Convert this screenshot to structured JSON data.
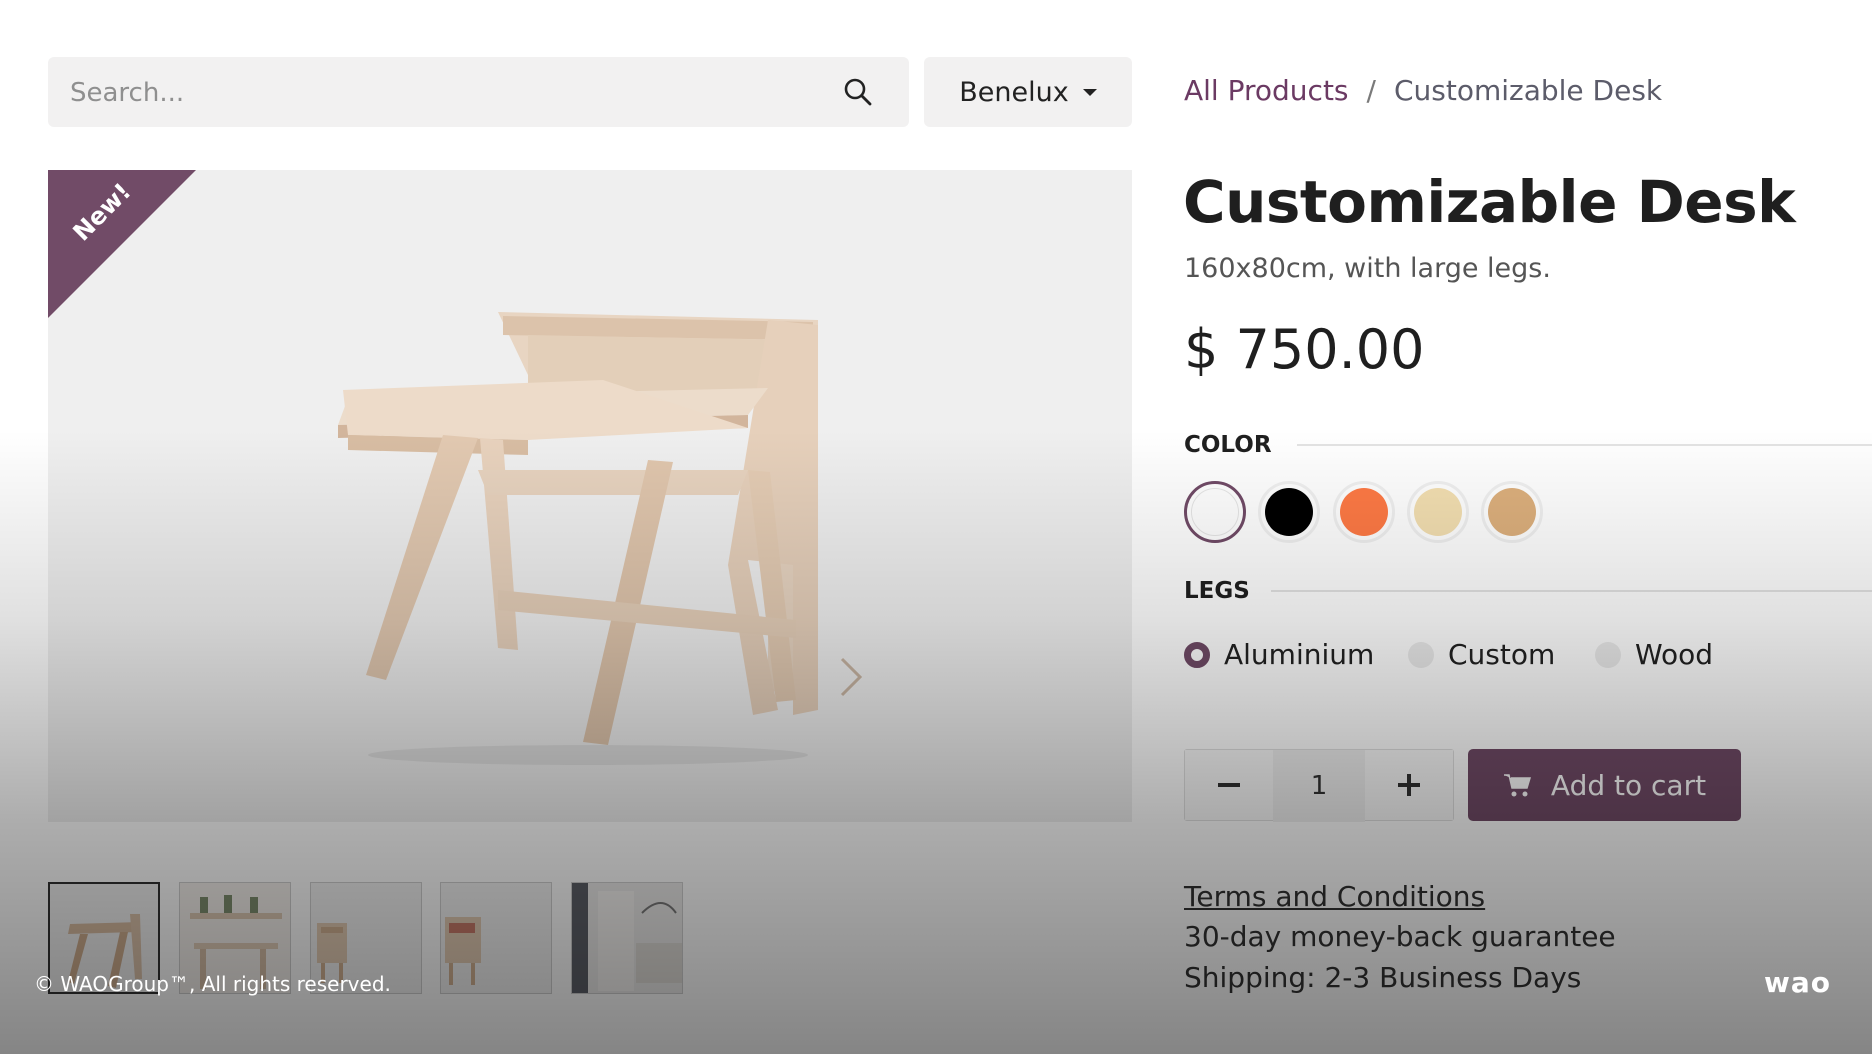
{
  "search": {
    "placeholder": "Search..."
  },
  "pricelist": {
    "label": "Benelux"
  },
  "breadcrumb": {
    "parent": "All Products",
    "separator": "/",
    "current": "Customizable Desk"
  },
  "badge": {
    "label": "New!"
  },
  "product": {
    "title": "Customizable Desk",
    "description": "160x80cm, with large legs.",
    "price": "$ 750.00"
  },
  "attributes": {
    "color": {
      "label": "COLOR",
      "swatches": [
        {
          "name": "White",
          "hex": "#ffffff",
          "selected": true
        },
        {
          "name": "Black",
          "hex": "#000000",
          "selected": false
        },
        {
          "name": "Orange",
          "hex": "#ff7a45",
          "selected": false
        },
        {
          "name": "Beige",
          "hex": "#f3dfb1",
          "selected": false
        },
        {
          "name": "Tan",
          "hex": "#ddb07d",
          "selected": false
        }
      ]
    },
    "legs": {
      "label": "LEGS",
      "options": [
        {
          "label": "Aluminium",
          "checked": true
        },
        {
          "label": "Custom",
          "checked": false
        },
        {
          "label": "Wood",
          "checked": false
        }
      ]
    }
  },
  "cart": {
    "quantity": "1",
    "minus_icon": "minus-icon",
    "plus_icon": "plus-icon",
    "add_label": "Add to cart",
    "add_icon": "cart-icon"
  },
  "info": {
    "terms": "Terms and Conditions",
    "guarantee": "30-day money-back guarantee",
    "shipping": "Shipping: 2-3 Business Days"
  },
  "footer": {
    "copyright": "© WAOGroup™, All rights reserved.",
    "logo": "wao"
  },
  "colors": {
    "accent": "#714b67",
    "field_bg": "#f2f1f1"
  }
}
